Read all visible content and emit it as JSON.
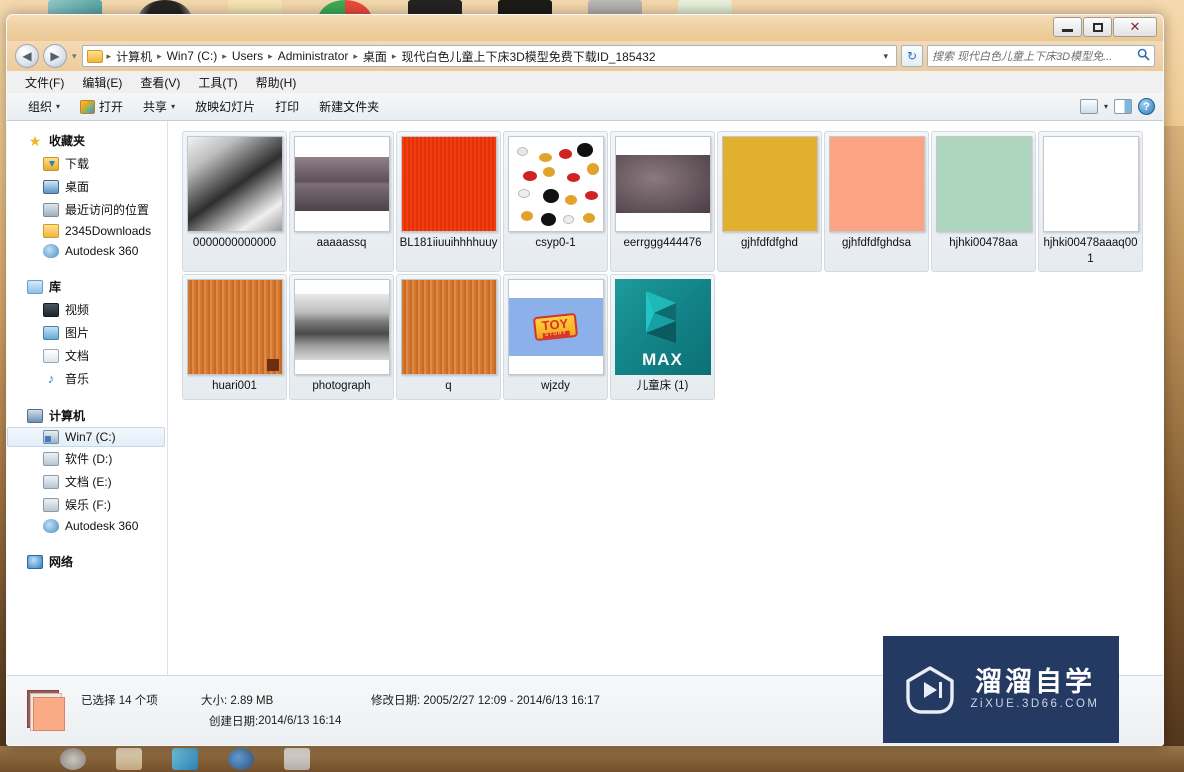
{
  "window": {
    "controls": {
      "minimize": "–",
      "maximize": "□",
      "close": "✕"
    }
  },
  "address": {
    "back_icon": "◀",
    "forward_icon": "▶",
    "history_caret": "▾",
    "folder_icon": "folder-icon",
    "crumbs": [
      "计算机",
      "Win7 (C:)",
      "Users",
      "Administrator",
      "桌面",
      "现代白色儿童上下床3D模型免费下载ID_185432"
    ],
    "separator": "▸",
    "dropdown_caret": "▾",
    "refresh_icon": "↻"
  },
  "search": {
    "placeholder": "搜索 现代白色儿童上下床3D模型免...",
    "icon": "search-icon"
  },
  "menu": {
    "items": [
      "文件(F)",
      "编辑(E)",
      "查看(V)",
      "工具(T)",
      "帮助(H)"
    ]
  },
  "toolbar": {
    "organize": "组织",
    "open": "打开",
    "share": "共享",
    "slideshow": "放映幻灯片",
    "print": "打印",
    "new_folder": "新建文件夹",
    "caret": "▾",
    "view_icon": "view-layout-icon",
    "pane_icon": "preview-pane-icon",
    "help_icon": "?"
  },
  "sidebar": {
    "groups": [
      {
        "name": "收藏夹",
        "icon": "star-icon",
        "items": [
          {
            "label": "下载",
            "icon": "downloads-icon"
          },
          {
            "label": "桌面",
            "icon": "desktop-icon"
          },
          {
            "label": "最近访问的位置",
            "icon": "recent-places-icon"
          },
          {
            "label": "2345Downloads",
            "icon": "folder-icon"
          },
          {
            "label": "Autodesk 360",
            "icon": "cloud-icon"
          }
        ]
      },
      {
        "name": "库",
        "icon": "library-icon",
        "items": [
          {
            "label": "视频",
            "icon": "video-icon"
          },
          {
            "label": "图片",
            "icon": "pictures-icon"
          },
          {
            "label": "文档",
            "icon": "documents-icon"
          },
          {
            "label": "音乐",
            "icon": "music-icon"
          }
        ]
      },
      {
        "name": "计算机",
        "icon": "computer-icon",
        "items": [
          {
            "label": "Win7 (C:)",
            "icon": "system-drive-icon",
            "selected": true
          },
          {
            "label": "软件 (D:)",
            "icon": "drive-icon"
          },
          {
            "label": "文档 (E:)",
            "icon": "drive-icon"
          },
          {
            "label": "娱乐 (F:)",
            "icon": "drive-icon"
          },
          {
            "label": "Autodesk 360",
            "icon": "cloud-icon"
          }
        ]
      },
      {
        "name": "网络",
        "icon": "network-icon",
        "items": []
      }
    ]
  },
  "files": [
    {
      "name": "0000000000000",
      "thumb": "t-car",
      "kind": "image",
      "selected": true
    },
    {
      "name": "aaaaassq",
      "thumb": "t-pillow",
      "kind": "image",
      "selected": true
    },
    {
      "name": "BL181iiuuihhhhuuy",
      "thumb": "t-red",
      "kind": "image",
      "selected": true
    },
    {
      "name": "csyp0-1",
      "thumb": "t-mickey",
      "kind": "image",
      "selected": true
    },
    {
      "name": "eerrggg444476",
      "thumb": "t-eerr",
      "kind": "image",
      "selected": true
    },
    {
      "name": "gjhfdfdfghd",
      "thumb": "t-gold",
      "kind": "image",
      "selected": true,
      "color": "#E0B02E"
    },
    {
      "name": "gjhfdfdfghdsa",
      "thumb": "t-salmon",
      "kind": "image",
      "selected": true,
      "color": "#FCA383"
    },
    {
      "name": "hjhki00478aa",
      "thumb": "t-mint",
      "kind": "image",
      "selected": true,
      "color": "#ADD4BC"
    },
    {
      "name": "hjhki00478aaaq001",
      "thumb": "t-white",
      "kind": "image",
      "selected": true,
      "color": "#FFFFFF"
    },
    {
      "name": "huari001",
      "thumb": "t-wood",
      "kind": "image",
      "selected": true
    },
    {
      "name": "photograph",
      "thumb": "t-photo",
      "kind": "image",
      "selected": true
    },
    {
      "name": "q",
      "thumb": "t-wood2",
      "kind": "image",
      "selected": true
    },
    {
      "name": "wjzdy",
      "thumb": "t-toy",
      "kind": "image",
      "selected": true,
      "overlay": "TOY STORY"
    },
    {
      "name": "儿童床 (1)",
      "thumb": "t-max",
      "kind": "max",
      "selected": true,
      "overlay": "MAX"
    }
  ],
  "status": {
    "selected_label": "已选择",
    "selected_count": "14 个项",
    "size_label": "大小:",
    "size_value": "2.89 MB",
    "modified_label": "修改日期:",
    "modified_value": "2005/2/27 12:09 - 2014/6/13 16:17",
    "created_label": "创建日期:",
    "created_value": "2014/6/13 16:14"
  },
  "watermark": {
    "cn": "溜溜自学",
    "en": "ZiXUE.3D66.COM",
    "bg": "#253A63",
    "play_icon": "play-button-icon"
  }
}
